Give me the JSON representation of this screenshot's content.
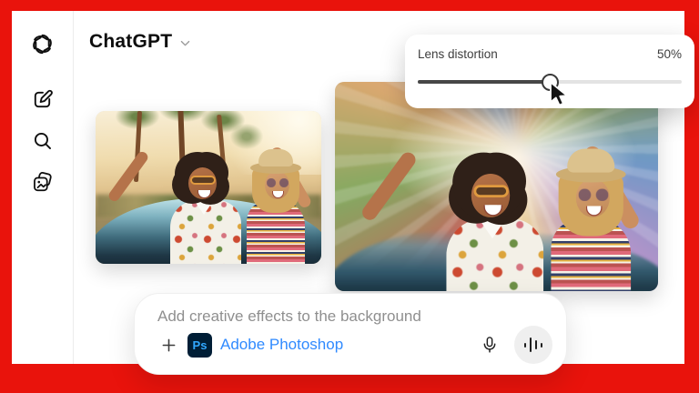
{
  "frame": {
    "color": "#e9130c"
  },
  "header": {
    "title": "ChatGPT"
  },
  "sidebar": {
    "items": [
      {
        "icon": "openai-logo"
      },
      {
        "icon": "compose-icon"
      },
      {
        "icon": "search-icon"
      },
      {
        "icon": "library-icon"
      }
    ]
  },
  "effect_panel": {
    "label": "Lens distortion",
    "value": "50%",
    "percent": 50
  },
  "attachments": {
    "original_alt": "Photo: two friends laughing in a blue convertible on a desert road lined with palm trees",
    "edited_alt": "Edited photo: the same friends with a radial zoom lens-distortion effect applied to the background"
  },
  "composer": {
    "prompt": "Add creative effects to the background",
    "plugin_badge": "Ps",
    "plugin_name": "Adobe Photoshop"
  },
  "colors": {
    "frame_red": "#e9130c",
    "link_blue": "#2f8aff",
    "photoshop_navy": "#001e36",
    "photoshop_blue": "#31a8ff"
  }
}
